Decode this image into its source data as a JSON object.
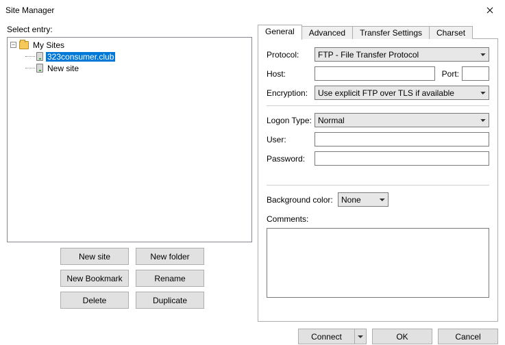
{
  "window": {
    "title": "Site Manager"
  },
  "left": {
    "select_label": "Select entry:",
    "tree": {
      "root_label": "My Sites",
      "site1_label": "323consumer.club",
      "site2_label": "New site"
    },
    "buttons": {
      "new_site": "New site",
      "new_folder": "New folder",
      "new_bookmark": "New Bookmark",
      "rename": "Rename",
      "delete": "Delete",
      "duplicate": "Duplicate"
    }
  },
  "tabs": {
    "general": "General",
    "advanced": "Advanced",
    "transfer": "Transfer Settings",
    "charset": "Charset"
  },
  "form": {
    "protocol_label": "Protocol:",
    "protocol_value": "FTP - File Transfer Protocol",
    "host_label": "Host:",
    "host_value": "",
    "port_label": "Port:",
    "port_value": "",
    "encryption_label": "Encryption:",
    "encryption_value": "Use explicit FTP over TLS if available",
    "logon_label": "Logon Type:",
    "logon_value": "Normal",
    "user_label": "User:",
    "user_value": "",
    "password_label": "Password:",
    "password_value": "",
    "bgcolor_label": "Background color:",
    "bgcolor_value": "None",
    "comments_label": "Comments:",
    "comments_value": ""
  },
  "footer": {
    "connect": "Connect",
    "ok": "OK",
    "cancel": "Cancel"
  }
}
